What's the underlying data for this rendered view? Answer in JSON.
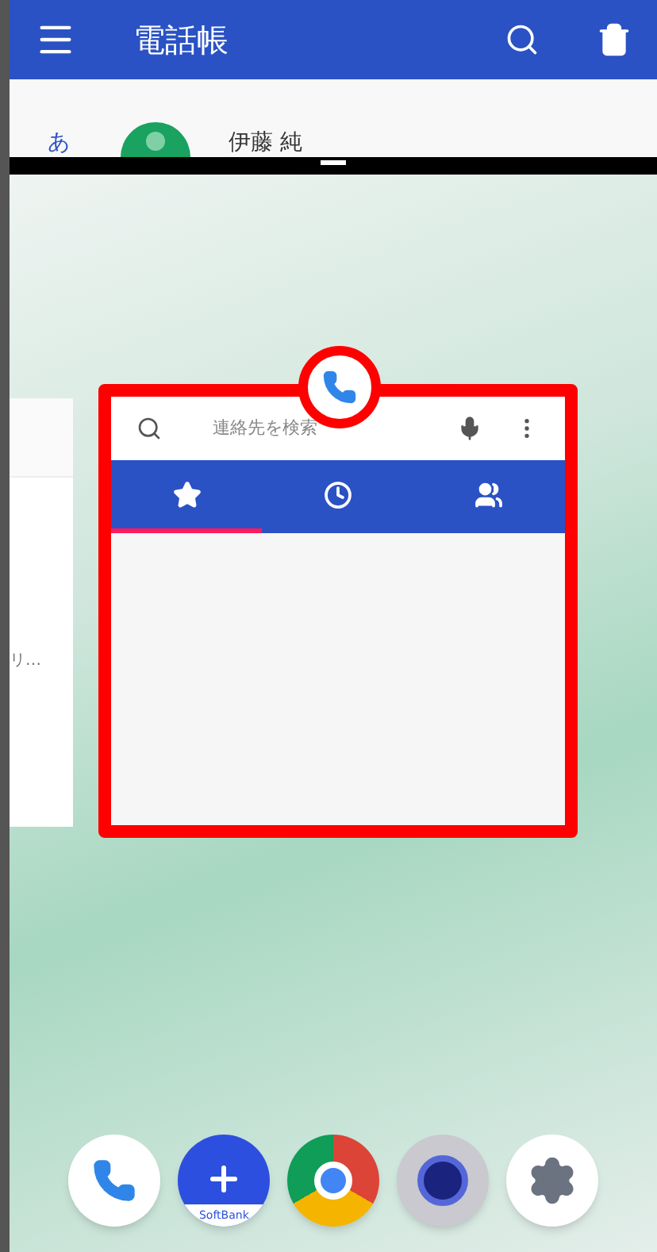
{
  "top_app": {
    "title": "電話帳",
    "index_letter": "あ",
    "contact_name": "伊藤 純"
  },
  "side_card": {
    "text": "リ…"
  },
  "focused_app": {
    "search": {
      "placeholder": "連絡先を検索"
    },
    "tabs": [
      {
        "kind": "star",
        "selected": true
      },
      {
        "kind": "clock",
        "selected": false
      },
      {
        "kind": "people",
        "selected": false
      }
    ]
  },
  "dock": [
    {
      "kind": "phone"
    },
    {
      "kind": "message",
      "label": "SoftBank"
    },
    {
      "kind": "browser"
    },
    {
      "kind": "camera"
    },
    {
      "kind": "settings"
    }
  ]
}
